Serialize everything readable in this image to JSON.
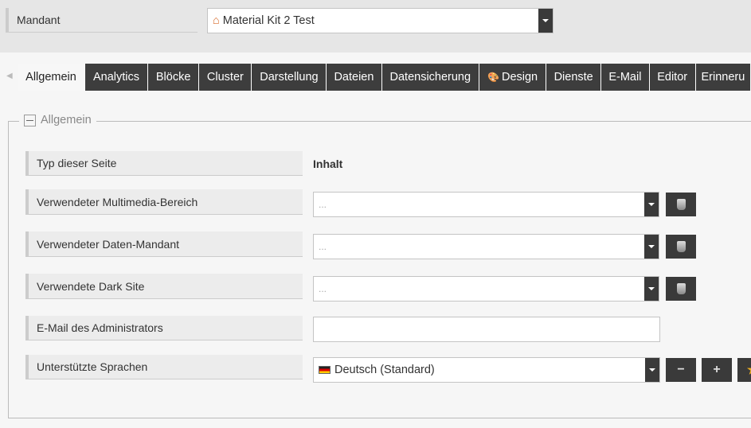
{
  "mandant": {
    "label": "Mandant",
    "value": "Material Kit 2 Test",
    "icon": "house-icon"
  },
  "tabs": [
    {
      "label": "Allgemein",
      "active": true
    },
    {
      "label": "Analytics"
    },
    {
      "label": "Blöcke"
    },
    {
      "label": "Cluster"
    },
    {
      "label": "Darstellung"
    },
    {
      "label": "Dateien"
    },
    {
      "label": "Datensicherung"
    },
    {
      "label": "Design",
      "icon": "palette-icon"
    },
    {
      "label": "Dienste"
    },
    {
      "label": "E-Mail"
    },
    {
      "label": "Editor"
    },
    {
      "label": "Erinneru"
    }
  ],
  "section": {
    "title": "Allgemein"
  },
  "fields": {
    "typ": {
      "label": "Typ dieser Seite",
      "value": "Inhalt"
    },
    "multimedia": {
      "label": "Verwendeter Multimedia-Bereich",
      "placeholder": "..."
    },
    "daten": {
      "label": "Verwendeter Daten-Mandant",
      "placeholder": "..."
    },
    "dark": {
      "label": "Verwendete Dark Site",
      "placeholder": "..."
    },
    "email": {
      "label": "E-Mail des Administrators",
      "value": ""
    },
    "sprachen": {
      "label": "Unterstützte Sprachen",
      "value": "Deutsch (Standard)",
      "remove": "−",
      "add": "+"
    }
  }
}
